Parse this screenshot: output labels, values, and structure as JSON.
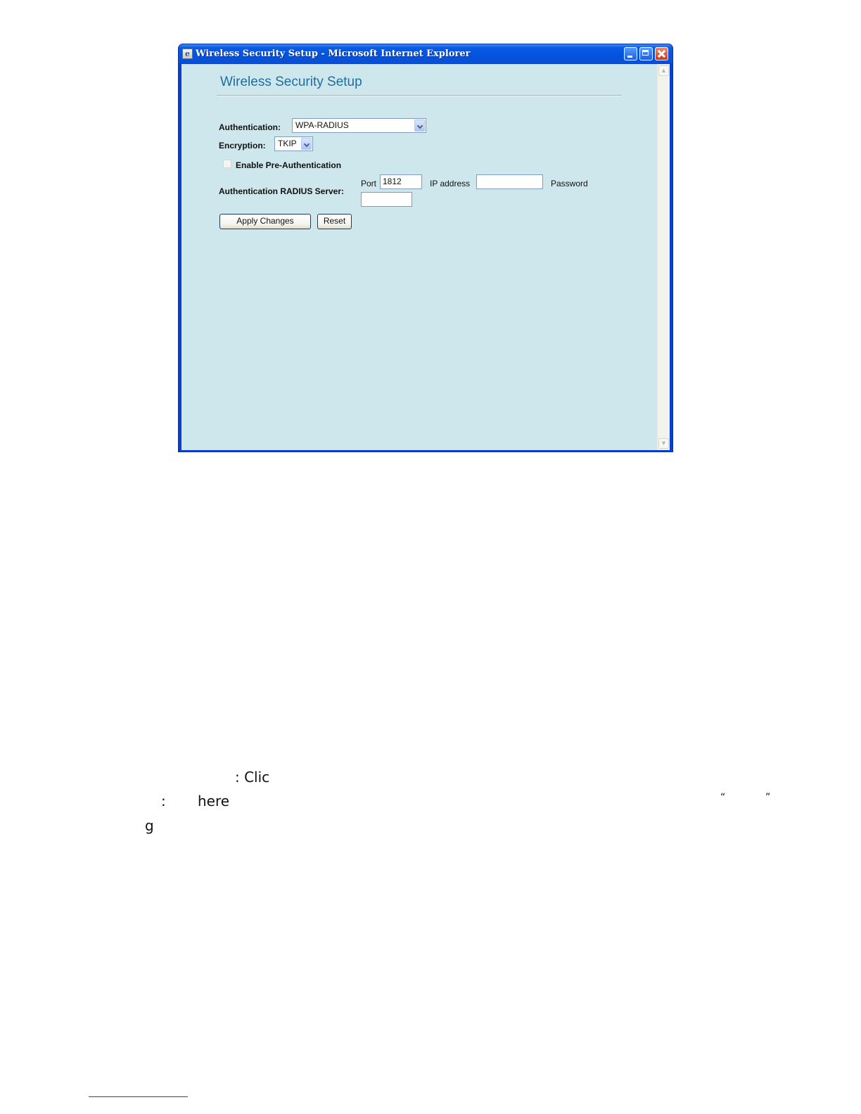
{
  "window": {
    "title": "Wireless Security Setup - Microsoft Internet Explorer",
    "controls": [
      "minimize",
      "maximize",
      "close"
    ]
  },
  "form": {
    "heading": "Wireless Security Setup",
    "authentication": {
      "label": "Authentication:",
      "value": "WPA-RADIUS"
    },
    "encryption": {
      "label": "Encryption:",
      "value": "TKIP"
    },
    "pre_auth": {
      "label": "Enable Pre-Authentication",
      "checked": false
    },
    "radius": {
      "label": "Authentication RADIUS Server:",
      "port_label": "Port",
      "port_value": "1812",
      "ip_label": "IP address",
      "ip_value": "",
      "password_label": "Password",
      "password_value": ""
    },
    "buttons": {
      "apply": "Apply Changes",
      "reset": "Reset"
    }
  },
  "document": {
    "line1": ": Clic",
    "line2_colon": ":",
    "line2_word": "here",
    "open_quote": "“",
    "close_quote": "”",
    "line3": "g"
  },
  "colors": {
    "title_bar": "#0453dd",
    "content_bg": "#cde7ec",
    "heading": "#1f6f9b",
    "close_button": "#c83c1d"
  }
}
